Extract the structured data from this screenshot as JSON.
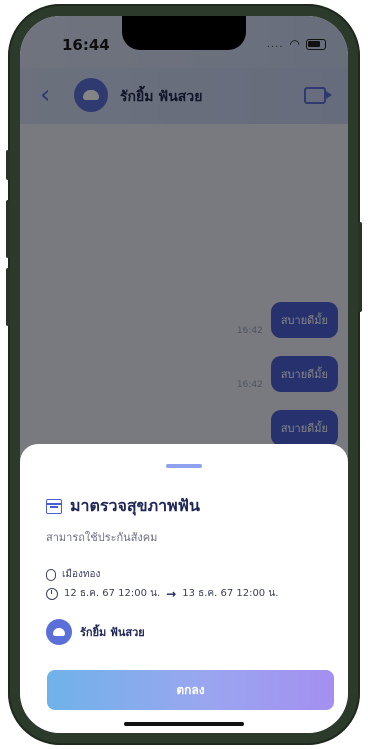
{
  "status_bar": {
    "time": "16:44"
  },
  "chat": {
    "contact_name": "รักยิ้ม ฟันสวย",
    "messages": [
      {
        "text": "สบายดีมั้ย",
        "time": "16:42"
      },
      {
        "text": "สบายดีมั้ย",
        "time": "16:42"
      },
      {
        "text": "สบายดีมั้ย",
        "time": ""
      }
    ]
  },
  "sheet": {
    "title": "มาตรวจสุขภาพฟัน",
    "subtitle": "สามารถใช้ประกันสังคม",
    "location": "เมืองทอง",
    "start": "12 ธ.ค. 67 12:00 น.",
    "arrow": "→",
    "end": "13 ธ.ค. 67 12:00 น.",
    "doctor_name": "รักยิ้ม ฟันสวย",
    "button_label": "ตกลง"
  },
  "colors": {
    "accent": "#4a5fd4",
    "button_gradient_start": "#6fb2ea",
    "button_gradient_end": "#a48ff0"
  }
}
